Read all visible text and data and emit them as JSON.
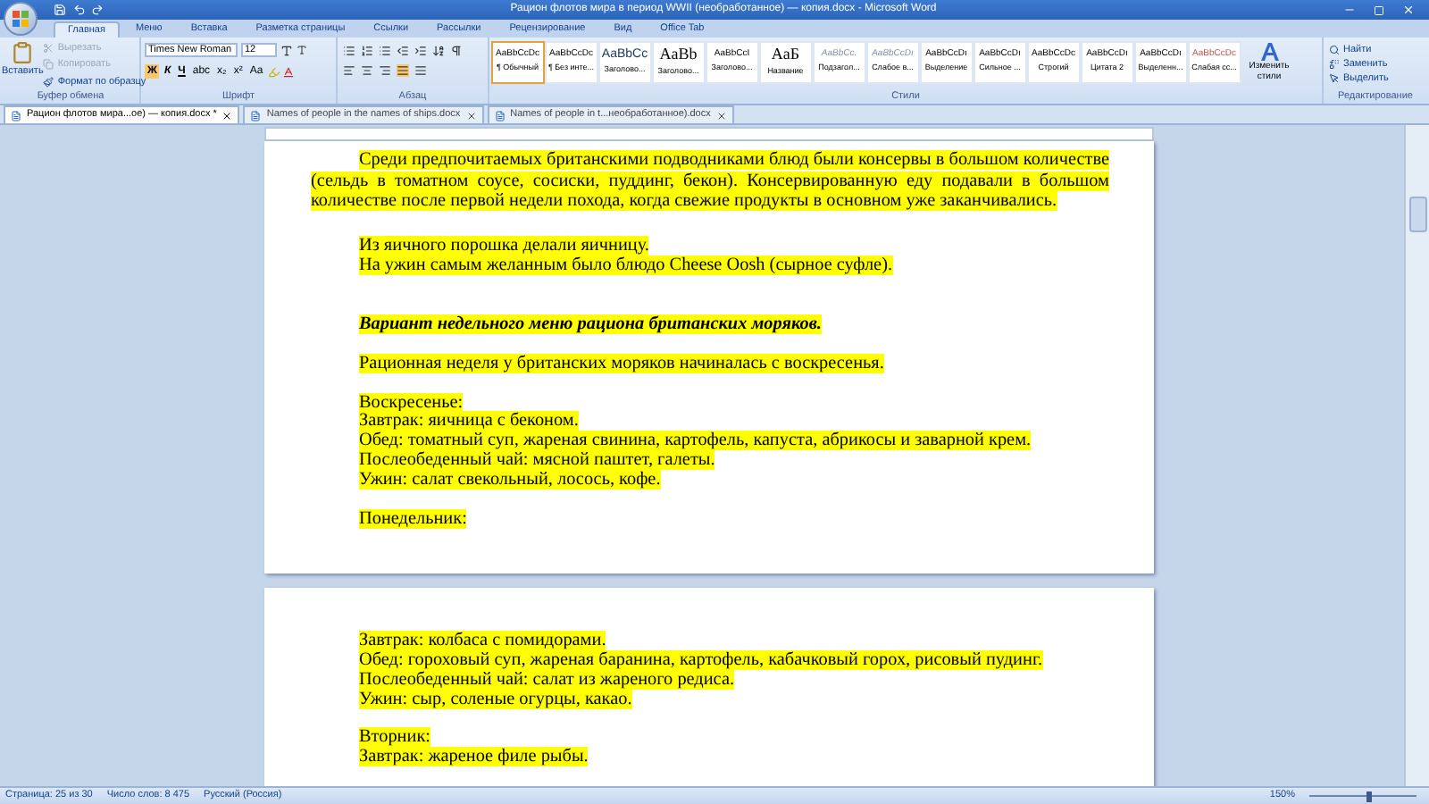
{
  "window": {
    "title": "Рацион флотов мира в период WWII (необработанное) — копия.docx - Microsoft Word"
  },
  "ribbon_tabs": [
    {
      "label": "Главная",
      "selected": true
    },
    {
      "label": "Меню",
      "selected": false
    },
    {
      "label": "Вставка",
      "selected": false
    },
    {
      "label": "Разметка страницы",
      "selected": false
    },
    {
      "label": "Ссылки",
      "selected": false
    },
    {
      "label": "Рассылки",
      "selected": false
    },
    {
      "label": "Рецензирование",
      "selected": false
    },
    {
      "label": "Вид",
      "selected": false
    },
    {
      "label": "Office Tab",
      "selected": false
    }
  ],
  "clipboard": {
    "paste": "Вставить",
    "items": [
      {
        "label": "Вырезать",
        "disabled": true
      },
      {
        "label": "Копировать",
        "disabled": true
      },
      {
        "label": "Формат по образцу",
        "disabled": false
      }
    ],
    "label": "Буфер обмена"
  },
  "font": {
    "name": "Times New Roman",
    "size": "12",
    "buttons": [
      "Ж",
      "К",
      "Ч",
      "abc",
      "x₂",
      "x²",
      "Aa"
    ],
    "label": "Шрифт"
  },
  "paragraph": {
    "label": "Абзац"
  },
  "styles": {
    "items": [
      {
        "sample": "AaBbCcDc",
        "name": "¶ Обычный",
        "selected": true
      },
      {
        "sample": "AaBbCcDc",
        "name": "¶ Без инте...",
        "selected": false
      },
      {
        "sample": "AaBbCc",
        "name": "Заголово...",
        "selected": false
      },
      {
        "sample": "AaBb",
        "name": "Заголово...",
        "selected": false
      },
      {
        "sample": "AaBbCcI",
        "name": "Заголово...",
        "selected": false
      },
      {
        "sample": "AaБ",
        "name": "Название",
        "selected": false
      },
      {
        "sample": "AaBbCc.",
        "name": "Подзагол...",
        "selected": false
      },
      {
        "sample": "AaBbCcDı",
        "name": "Слабое в...",
        "selected": false
      },
      {
        "sample": "AaBbCcDı",
        "name": "Выделение",
        "selected": false
      },
      {
        "sample": "AaBbCcDı",
        "name": "Сильное ...",
        "selected": false
      },
      {
        "sample": "AaBbCcDc",
        "name": "Строгий",
        "selected": false
      },
      {
        "sample": "AaBbCcDı",
        "name": "Цитата 2",
        "selected": false
      },
      {
        "sample": "AaBbCcDı",
        "name": "Выделенн...",
        "selected": false
      },
      {
        "sample": "AaBbCcDc",
        "name": "Слабая сс...",
        "selected": false
      }
    ],
    "change": "Изменить стили",
    "label": "Стили"
  },
  "editing": {
    "items": [
      "Найти",
      "Заменить",
      "Выделить"
    ],
    "label": "Редактирование"
  },
  "doc_tabs": [
    {
      "label": "Рацион флотов мира...ое) — копия.docx *",
      "selected": true
    },
    {
      "label": "Names of people in the names of ships.docx",
      "selected": false
    },
    {
      "label": "Names of people in t...необработанное).docx",
      "selected": false
    }
  ],
  "pages": [
    {
      "paragraphs": [
        {
          "kind": "justify",
          "text": "Среди предпочитаемых британскими подводниками блюд были консервы в большом количестве (сельдь в томатном соусе, сосиски, пуддинг, бекон). Консервированную еду подавали в большом количестве после первой недели похода, когда свежие продукты в основном уже заканчивались."
        },
        {
          "kind": "blank"
        },
        {
          "kind": "line",
          "text": "Из яичного порошка делали яичницу."
        },
        {
          "kind": "line",
          "text": "На ужин самым желанным было блюдо Cheese Oosh (сырное суфле)."
        },
        {
          "kind": "blank"
        },
        {
          "kind": "blank"
        },
        {
          "kind": "heading",
          "text": "Вариант недельного меню рациона британских моряков."
        },
        {
          "kind": "blank"
        },
        {
          "kind": "line",
          "text": "Рационная неделя у британских моряков начиналась с воскресенья."
        },
        {
          "kind": "blank"
        },
        {
          "kind": "line",
          "text": "Воскресенье:"
        },
        {
          "kind": "line",
          "text": "Завтрак: яичница с беконом."
        },
        {
          "kind": "line",
          "text": "Обед: томатный суп, жареная свинина, картофель, капуста, абрикосы и заварной крем."
        },
        {
          "kind": "line",
          "text": "Послеобеденный чай: мясной паштет, галеты."
        },
        {
          "kind": "line",
          "text": "Ужин: салат свекольный, лосось, кофе."
        },
        {
          "kind": "blank"
        },
        {
          "kind": "line",
          "text": "Понедельник:"
        }
      ]
    },
    {
      "paragraphs": [
        {
          "kind": "line",
          "text": "Завтрак: колбаса с помидорами."
        },
        {
          "kind": "line",
          "text": "Обед: гороховый суп, жареная баранина, картофель, кабачковый горох, рисовый пудинг."
        },
        {
          "kind": "line",
          "text": "Послеобеденный чай: салат из жареного редиса."
        },
        {
          "kind": "line",
          "text": "Ужин: сыр, соленые огурцы, какао."
        },
        {
          "kind": "blank"
        },
        {
          "kind": "line",
          "text": "Вторник:"
        },
        {
          "kind": "line",
          "text": "Завтрак: жареное филе рыбы."
        }
      ]
    }
  ],
  "status_bar": {
    "page": "Страница: 25 из 30",
    "words": "Число слов: 8 475",
    "language": "Русский (Россия)",
    "zoom": "150%",
    "zoom_slider": {
      "level": 0.55
    }
  }
}
